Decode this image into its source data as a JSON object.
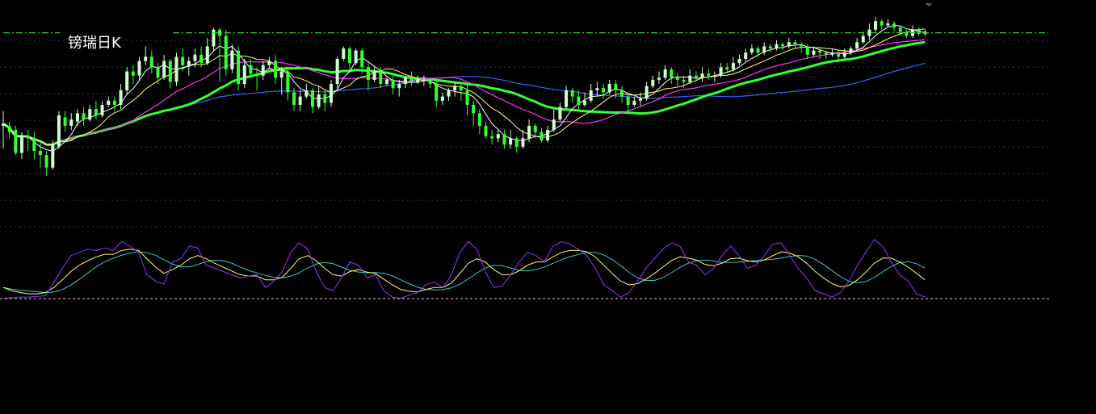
{
  "chart_data": {
    "type": "candlestick",
    "title": "镑瑞日K",
    "colors": {
      "background": "#000000",
      "grid": "#3a3a3a",
      "candle_up": "#ccffcc",
      "candle_down": "#33ff33",
      "ref_line": "#33cc33",
      "ma5": "#ffffff",
      "ma10": "#ffff66",
      "ma20": "#ff33ff",
      "ma30": "#33ff33",
      "ma60": "#3366ff",
      "k_line": "#ffff66",
      "d_line": "#33cccc",
      "j_line": "#9933ff",
      "sub_baseline": "#cccccc"
    },
    "price_range": [
      0,
      100
    ],
    "reference_level": 90.5,
    "candles": [
      [
        46,
        47,
        35,
        53
      ],
      [
        46,
        43,
        40,
        48
      ],
      [
        44,
        33,
        32,
        46
      ],
      [
        33,
        41,
        30,
        43
      ],
      [
        41,
        40,
        34,
        44
      ],
      [
        40,
        34,
        30,
        43
      ],
      [
        34,
        32,
        26,
        38
      ],
      [
        32,
        26,
        22,
        34
      ],
      [
        26,
        37,
        25,
        39
      ],
      [
        36,
        51,
        35,
        53
      ],
      [
        50,
        46,
        43,
        53
      ],
      [
        46,
        49,
        44,
        52
      ],
      [
        48,
        52,
        46,
        54
      ],
      [
        52,
        49,
        46,
        55
      ],
      [
        49,
        54,
        48,
        56
      ],
      [
        54,
        51,
        49,
        58
      ],
      [
        51,
        56,
        50,
        58
      ],
      [
        56,
        58,
        55,
        60
      ],
      [
        58,
        56,
        53,
        60
      ],
      [
        56,
        63,
        54,
        66
      ],
      [
        63,
        72,
        61,
        74
      ],
      [
        72,
        70,
        66,
        75
      ],
      [
        70,
        77,
        68,
        79
      ],
      [
        77,
        79,
        75,
        84
      ],
      [
        79,
        74,
        71,
        82
      ],
      [
        74,
        69,
        66,
        76
      ],
      [
        69,
        77,
        68,
        80
      ],
      [
        77,
        67,
        64,
        78
      ],
      [
        67,
        79,
        65,
        81
      ],
      [
        79,
        75,
        72,
        83
      ],
      [
        75,
        77,
        70,
        79
      ],
      [
        77,
        80,
        74,
        83
      ],
      [
        80,
        76,
        74,
        84
      ],
      [
        76,
        84,
        75,
        88
      ],
      [
        84,
        92,
        82,
        93
      ],
      [
        92,
        89,
        67,
        93
      ],
      [
        89,
        73,
        70,
        92
      ],
      [
        73,
        82,
        71,
        85
      ],
      [
        82,
        66,
        63,
        84
      ],
      [
        66,
        75,
        64,
        78
      ],
      [
        75,
        71,
        70,
        78
      ],
      [
        71,
        70,
        63,
        74
      ],
      [
        70,
        75,
        68,
        77
      ],
      [
        75,
        77,
        73,
        79
      ],
      [
        77,
        69,
        66,
        80
      ],
      [
        69,
        72,
        61,
        74
      ],
      [
        72,
        62,
        58,
        73
      ],
      [
        62,
        56,
        53,
        64
      ],
      [
        56,
        60,
        53,
        63
      ],
      [
        60,
        63,
        59,
        66
      ],
      [
        63,
        55,
        52,
        64
      ],
      [
        55,
        61,
        54,
        65
      ],
      [
        61,
        57,
        53,
        63
      ],
      [
        57,
        66,
        55,
        68
      ],
      [
        66,
        78,
        64,
        79
      ],
      [
        78,
        83,
        77,
        84
      ],
      [
        83,
        76,
        73,
        84
      ],
      [
        76,
        82,
        75,
        83
      ],
      [
        82,
        74,
        71,
        83
      ],
      [
        74,
        68,
        63,
        77
      ],
      [
        68,
        72,
        67,
        74
      ],
      [
        72,
        66,
        64,
        74
      ],
      [
        66,
        68,
        65,
        69
      ],
      [
        68,
        64,
        61,
        70
      ],
      [
        64,
        66,
        60,
        68
      ],
      [
        66,
        69,
        64,
        70
      ],
      [
        69,
        67,
        65,
        72
      ],
      [
        67,
        68,
        66,
        70
      ],
      [
        68,
        68,
        65,
        70
      ],
      [
        68,
        66,
        64,
        69
      ],
      [
        66,
        58,
        55,
        67
      ],
      [
        58,
        60,
        56,
        62
      ],
      [
        60,
        63,
        58,
        64
      ],
      [
        63,
        65,
        60,
        67
      ],
      [
        65,
        63,
        58,
        66
      ],
      [
        63,
        56,
        51,
        66
      ],
      [
        56,
        52,
        46,
        58
      ],
      [
        52,
        46,
        42,
        54
      ],
      [
        46,
        41,
        40,
        48
      ],
      [
        41,
        40,
        37,
        44
      ],
      [
        40,
        42,
        38,
        44
      ],
      [
        42,
        37,
        35,
        44
      ],
      [
        37,
        40,
        35,
        44
      ],
      [
        40,
        36,
        33,
        41
      ],
      [
        36,
        40,
        35,
        44
      ],
      [
        40,
        46,
        38,
        49
      ],
      [
        46,
        43,
        40,
        47
      ],
      [
        43,
        39,
        38,
        45
      ],
      [
        39,
        44,
        38,
        46
      ],
      [
        44,
        49,
        43,
        54
      ],
      [
        49,
        55,
        48,
        57
      ],
      [
        55,
        63,
        54,
        65
      ],
      [
        63,
        60,
        57,
        64
      ],
      [
        60,
        56,
        53,
        63
      ],
      [
        56,
        58,
        55,
        62
      ],
      [
        58,
        63,
        57,
        66
      ],
      [
        63,
        64,
        60,
        67
      ],
      [
        64,
        62,
        59,
        66
      ],
      [
        62,
        66,
        61,
        68
      ],
      [
        66,
        63,
        59,
        68
      ],
      [
        63,
        60,
        57,
        65
      ],
      [
        60,
        56,
        52,
        62
      ],
      [
        56,
        58,
        55,
        60
      ],
      [
        58,
        59,
        55,
        62
      ],
      [
        59,
        65,
        58,
        67
      ],
      [
        65,
        68,
        64,
        70
      ],
      [
        68,
        69,
        66,
        72
      ],
      [
        69,
        73,
        68,
        75
      ],
      [
        73,
        69,
        66,
        74
      ],
      [
        69,
        68,
        65,
        71
      ],
      [
        68,
        67,
        64,
        70
      ],
      [
        67,
        70,
        66,
        73
      ],
      [
        70,
        69,
        67,
        72
      ],
      [
        69,
        71,
        67,
        74
      ],
      [
        71,
        70,
        68,
        73
      ],
      [
        70,
        70,
        67,
        72
      ],
      [
        70,
        74,
        69,
        76
      ],
      [
        74,
        73,
        71,
        76
      ],
      [
        73,
        76,
        72,
        79
      ],
      [
        76,
        78,
        75,
        80
      ],
      [
        78,
        81,
        77,
        83
      ],
      [
        81,
        83,
        80,
        85
      ],
      [
        83,
        81,
        79,
        84
      ],
      [
        81,
        84,
        80,
        86
      ],
      [
        84,
        83,
        81,
        85
      ],
      [
        83,
        85,
        82,
        87
      ],
      [
        85,
        84,
        82,
        86
      ],
      [
        84,
        86,
        83,
        88
      ],
      [
        86,
        85,
        83,
        87
      ],
      [
        85,
        84,
        81,
        86
      ],
      [
        84,
        80,
        78,
        85
      ],
      [
        80,
        82,
        79,
        84
      ],
      [
        82,
        81,
        78,
        83
      ],
      [
        81,
        80,
        78,
        82
      ],
      [
        80,
        81,
        79,
        83
      ],
      [
        81,
        79,
        77,
        82
      ],
      [
        79,
        81,
        78,
        83
      ],
      [
        81,
        83,
        80,
        84
      ],
      [
        83,
        86,
        82,
        88
      ],
      [
        86,
        89,
        85,
        91
      ],
      [
        89,
        92,
        87,
        95
      ],
      [
        92,
        96,
        91,
        98
      ],
      [
        96,
        94,
        92,
        97
      ],
      [
        94,
        95,
        93,
        97
      ],
      [
        95,
        93,
        91,
        96
      ],
      [
        93,
        91,
        89,
        94
      ],
      [
        91,
        89,
        88,
        92
      ],
      [
        89,
        92,
        88,
        94
      ],
      [
        92,
        90,
        89,
        93
      ],
      [
        90,
        91,
        89,
        92
      ]
    ],
    "kdj": {
      "range": [
        0,
        100
      ],
      "j": [
        3,
        4,
        5,
        5,
        6,
        7,
        28,
        50,
        70,
        75,
        80,
        78,
        82,
        78,
        92,
        85,
        75,
        40,
        30,
        25,
        60,
        65,
        85,
        82,
        55,
        50,
        45,
        40,
        35,
        38,
        40,
        20,
        30,
        45,
        75,
        90,
        80,
        45,
        20,
        15,
        35,
        60,
        55,
        35,
        40,
        15,
        5,
        3,
        8,
        12,
        25,
        28,
        20,
        40,
        75,
        92,
        80,
        45,
        20,
        22,
        40,
        60,
        75,
        70,
        60,
        85,
        92,
        88,
        80,
        70,
        50,
        25,
        15,
        5,
        12,
        30,
        50,
        65,
        80,
        90,
        85,
        60,
        55,
        40,
        50,
        70,
        85,
        70,
        50,
        55,
        70,
        88,
        90,
        70,
        50,
        35,
        15,
        10,
        5,
        12,
        30,
        55,
        75,
        95,
        85,
        60,
        40,
        30,
        10,
        5
      ],
      "k": [
        20,
        15,
        12,
        10,
        10,
        12,
        20,
        32,
        45,
        55,
        62,
        68,
        72,
        72,
        78,
        80,
        78,
        65,
        52,
        42,
        48,
        55,
        65,
        70,
        65,
        58,
        52,
        46,
        40,
        38,
        38,
        32,
        32,
        36,
        50,
        65,
        70,
        62,
        50,
        40,
        38,
        45,
        48,
        44,
        42,
        33,
        24,
        17,
        14,
        13,
        17,
        20,
        20,
        27,
        42,
        58,
        65,
        60,
        48,
        40,
        40,
        46,
        55,
        60,
        60,
        68,
        75,
        78,
        78,
        76,
        68,
        55,
        42,
        30,
        24,
        26,
        33,
        42,
        52,
        62,
        68,
        66,
        63,
        56,
        54,
        58,
        65,
        66,
        62,
        60,
        63,
        70,
        76,
        74,
        68,
        58,
        45,
        35,
        26,
        21,
        23,
        32,
        44,
        58,
        66,
        66,
        60,
        52,
        42,
        32
      ]
    }
  }
}
